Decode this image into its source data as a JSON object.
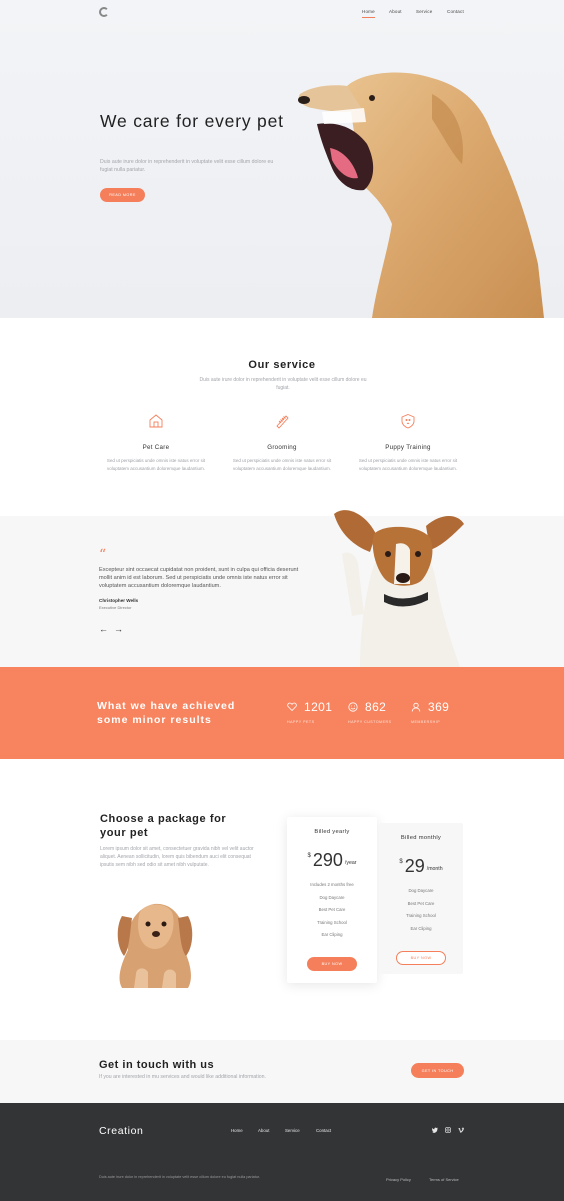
{
  "nav": {
    "items": [
      "Home",
      "About",
      "Service",
      "Contact"
    ]
  },
  "hero": {
    "title": "We care for every pet",
    "subtitle": "Duis aute irure dolor in reprehenderit in voluptate velit esse cillum dolore eu fugiat nulla pariatur.",
    "button": "Read More"
  },
  "service": {
    "title": "Our service",
    "subtitle": "Duis aute irure dolor in reprehenderit in voluptate velit esse cillum dolore eu fugiat.",
    "items": [
      {
        "title": "Pet Care",
        "icon": "house-icon",
        "text": "Sed ut perspiciatis unde omnis iste natus error sit voluptatem accusantium doloremque laudantium."
      },
      {
        "title": "Grooming",
        "icon": "comb-icon",
        "text": "Sed ut perspiciatis unde omnis iste natus error sit voluptatem accusantium doloremque laudantium."
      },
      {
        "title": "Puppy Training",
        "icon": "dog-shield-icon",
        "text": "Sed ut perspiciatis unde omnis iste natus error sit voluptatem accusantium doloremque laudantium."
      }
    ]
  },
  "testimonial": {
    "quote": "Excepteur sint occaecat cupidatat non proident, sunt in culpa qui officia deserunt mollit anim id est laborum. Sed ut perspiciatis unde omnis iste natus error sit voluptatem accusantium doloremque laudantium.",
    "name": "Christopher Wells",
    "role": "Executive Director",
    "prev": "←",
    "next": "→"
  },
  "achieve": {
    "title": "What we have achieved some minor results",
    "stats": [
      {
        "icon": "heart-icon",
        "value": "1201",
        "label": "Happy Pets"
      },
      {
        "icon": "smile-icon",
        "value": "862",
        "label": "Happy Customers"
      },
      {
        "icon": "users-icon",
        "value": "369",
        "label": "Membership"
      }
    ]
  },
  "pricing": {
    "title": "Choose a package for your pet",
    "text": "Lorem ipsum dolor sit amet, consectetuer gravida nibh vel velit auctor aliquet. Aenean sollicitudin, lorem quis bibendum auci elit consequat ipsutis sem nibh sed odio sit amet nibh vulputate.",
    "plans": [
      {
        "name": "Billed yearly",
        "currency": "$",
        "amount": "290",
        "period": "/year",
        "features": [
          "Includes 2 months free",
          "Dog Daycare",
          "Best Pet Care",
          "Training School",
          "Ear Cliping"
        ],
        "button": "Buy Now"
      },
      {
        "name": "Billed monthly",
        "currency": "$",
        "amount": "29",
        "period": "/month",
        "features": [
          "Dog Daycare",
          "Best Pet Care",
          "Training School",
          "Ear Cliping"
        ],
        "button": "Buy Now"
      }
    ]
  },
  "contact": {
    "title": "Get in touch with us",
    "subtitle": "If you are interested in mu services and would like additional information.",
    "button": "Get in touch"
  },
  "footer": {
    "logo": "Creation",
    "nav": [
      "Home",
      "About",
      "Service",
      "Contact"
    ],
    "social": [
      "twitter-icon",
      "instagram-icon",
      "vimeo-icon"
    ],
    "text": "Duis aute irure dolor in reprehenderit in voluptate velit esse cillum dolore eu fugiat nulla pariatur.",
    "links": [
      "Privacy Policy",
      "Terms of Service"
    ]
  },
  "colors": {
    "accent": "#f57f5b",
    "dark": "#333436",
    "light": "#f7f7f7"
  }
}
